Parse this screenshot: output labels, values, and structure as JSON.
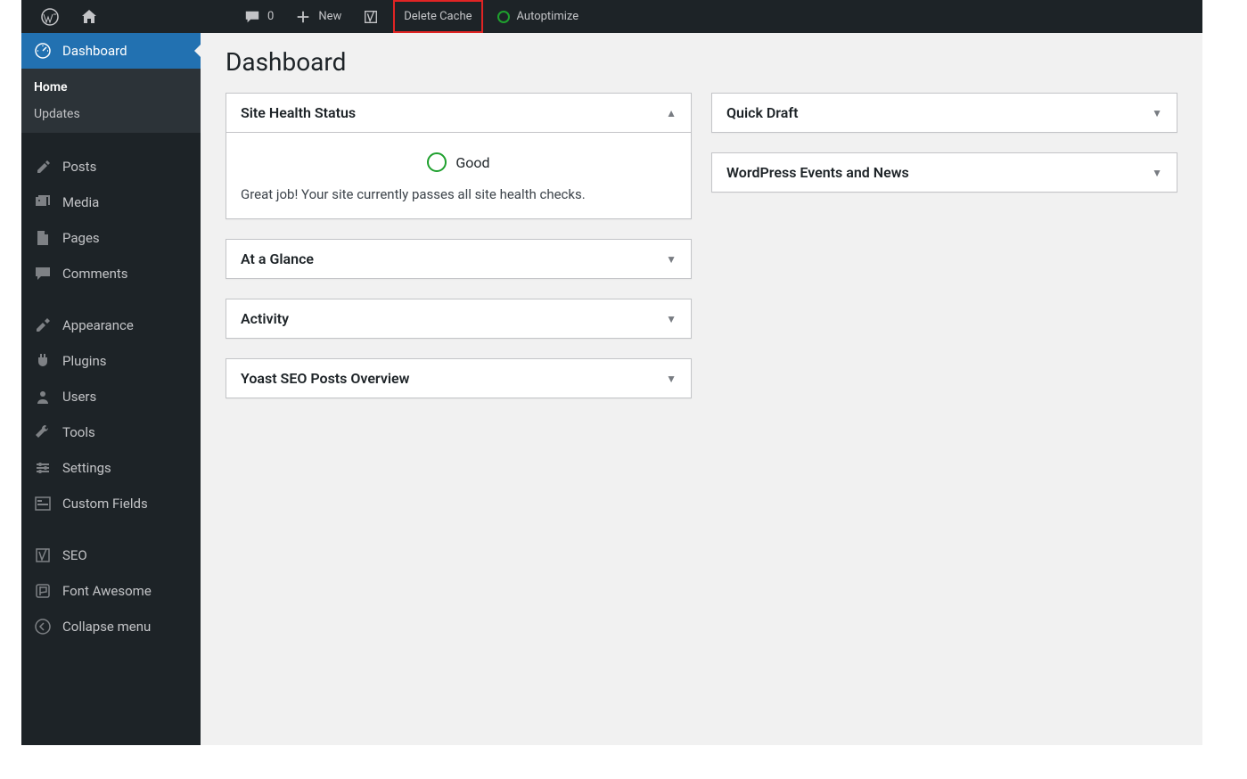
{
  "adminbar": {
    "comments_count": "0",
    "new_label": "New",
    "delete_cache_label": "Delete Cache",
    "autoptimize_label": "Autoptimize"
  },
  "sidebar": {
    "dashboard": "Dashboard",
    "submenu": {
      "home": "Home",
      "updates": "Updates"
    },
    "posts": "Posts",
    "media": "Media",
    "pages": "Pages",
    "comments": "Comments",
    "appearance": "Appearance",
    "plugins": "Plugins",
    "users": "Users",
    "tools": "Tools",
    "settings": "Settings",
    "custom_fields": "Custom Fields",
    "seo": "SEO",
    "font_awesome": "Font Awesome",
    "collapse": "Collapse menu"
  },
  "main": {
    "title": "Dashboard",
    "left": {
      "site_health": {
        "title": "Site Health Status",
        "status_label": "Good",
        "message": "Great job! Your site currently passes all site health checks."
      },
      "at_a_glance": {
        "title": "At a Glance"
      },
      "activity": {
        "title": "Activity"
      },
      "yoast": {
        "title": "Yoast SEO Posts Overview"
      }
    },
    "right": {
      "quick_draft": {
        "title": "Quick Draft"
      },
      "events": {
        "title": "WordPress Events and News"
      }
    }
  }
}
